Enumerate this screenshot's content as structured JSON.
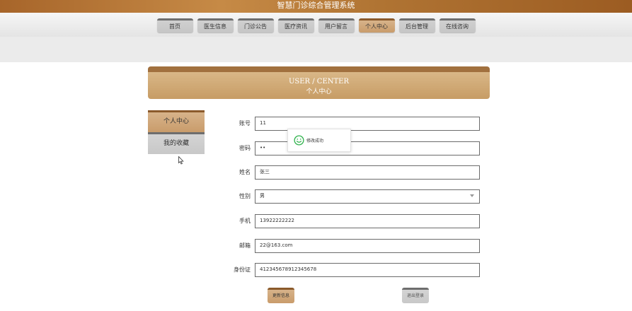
{
  "app_title": "智慧门诊综合管理系统",
  "nav": [
    "首页",
    "医生信息",
    "门诊公告",
    "医疗资讯",
    "用户留言",
    "个人中心",
    "后台管理",
    "在线咨询"
  ],
  "nav_active_index": 5,
  "banner": {
    "en": "USER / CENTER",
    "cn": "个人中心"
  },
  "sidebar": {
    "items": [
      "个人中心",
      "我的收藏"
    ],
    "active_index": 0
  },
  "form": {
    "account": {
      "label": "账号",
      "value": "11"
    },
    "password": {
      "label": "密码",
      "value": "••"
    },
    "name": {
      "label": "姓名",
      "value": "张三"
    },
    "gender": {
      "label": "性别",
      "value": "男"
    },
    "phone": {
      "label": "手机",
      "value": "13922222222"
    },
    "email": {
      "label": "邮箱",
      "value": "22@163.com"
    },
    "id_card": {
      "label": "身份证",
      "value": "412345678912345678"
    }
  },
  "buttons": {
    "update": "更新信息",
    "logout": "退出登录"
  },
  "toast": {
    "message": "修改成功",
    "icon": "smile-icon",
    "color": "#2fb24c"
  },
  "colors": {
    "accent": "#c99c6b",
    "accent_dark": "#8b5a2b",
    "header": "#b07433"
  }
}
